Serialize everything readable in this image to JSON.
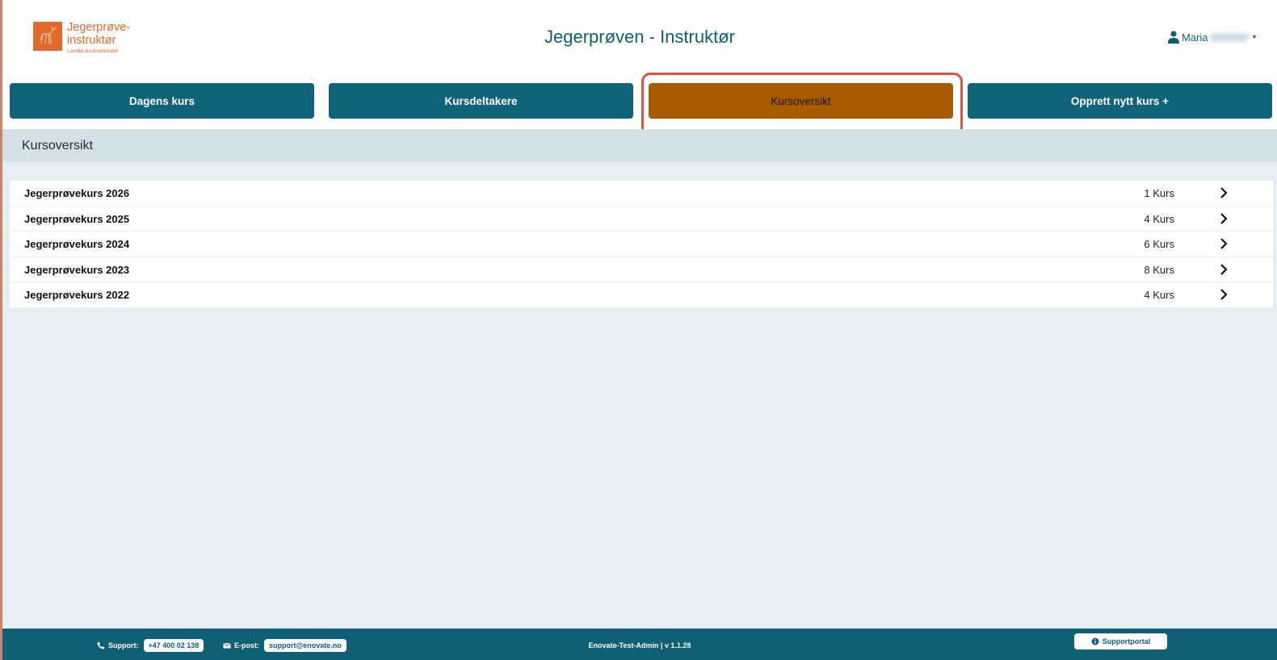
{
  "logo": {
    "line1": "Jegerprøve-",
    "line2": "instruktør",
    "sub": "Landbruksdirektoratet"
  },
  "header": {
    "title": "Jegerprøven - Instruktør",
    "user_name": "Maria"
  },
  "nav": {
    "items": [
      {
        "label": "Dagens kurs"
      },
      {
        "label": "Kursdeltakere"
      },
      {
        "label": "Kursoversikt"
      },
      {
        "label": "Opprett nytt kurs +"
      }
    ]
  },
  "section": {
    "title": "Kursoversikt"
  },
  "courses": [
    {
      "name": "Jegerprøvekurs 2026",
      "count": "1 Kurs"
    },
    {
      "name": "Jegerprøvekurs 2025",
      "count": "4 Kurs"
    },
    {
      "name": "Jegerprøvekurs 2024",
      "count": "6 Kurs"
    },
    {
      "name": "Jegerprøvekurs 2023",
      "count": "8 Kurs"
    },
    {
      "name": "Jegerprøvekurs 2022",
      "count": "4 Kurs"
    }
  ],
  "footer": {
    "support_label": "Support:",
    "support_phone": "+47 400 02 138",
    "email_label": "E-post:",
    "email": "support@enovate.no",
    "version": "Enovate-Test-Admin | v 1.1.28",
    "portal_label": "Supportportal"
  },
  "colors": {
    "primary": "#0f6479",
    "active": "#a85b00",
    "highlight": "#e0533e",
    "brand_orange": "#e06a2c"
  }
}
